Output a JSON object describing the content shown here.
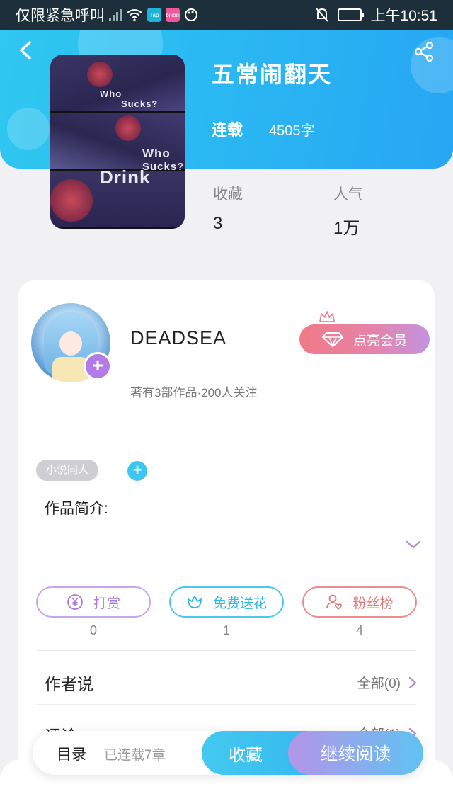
{
  "status_bar": {
    "carrier": "仅限紧急呼叫",
    "time": "上午10:51",
    "app_badges": [
      "Tap",
      "bilibili"
    ]
  },
  "book": {
    "title": "五常闹翻天",
    "serial_status": "连载",
    "word_count": "4505字",
    "favorites_label": "收藏",
    "favorites_value": "3",
    "popularity_label": "人气",
    "popularity_value": "1万",
    "cover_texts": [
      "Who",
      "Sucks?",
      "Who",
      "Sucks?",
      "Drink"
    ]
  },
  "author": {
    "name": "DEADSEA",
    "meta": "著有3部作品·200人关注",
    "vip_button": "点亮会员",
    "follow_icon": "plus-icon"
  },
  "tags": {
    "items": [
      "小说同人"
    ],
    "intro_label": "作品简介:"
  },
  "actions": [
    {
      "label": "打赏",
      "count": "0",
      "icon": "yen-coin-icon"
    },
    {
      "label": "免费送花",
      "count": "1",
      "icon": "flower-icon"
    },
    {
      "label": "粉丝榜",
      "count": "4",
      "icon": "fan-heart-icon"
    }
  ],
  "sections": [
    {
      "label": "作者说",
      "right": "全部(0)"
    },
    {
      "label": "评论",
      "right": "全部(1)"
    }
  ],
  "bottom_bar": {
    "toc_label": "目录",
    "chapter_status": "已连载7章",
    "favorite_label": "收藏",
    "continue_label": "继续阅读"
  },
  "colors": {
    "header_gradient_start": "#2fc8f0",
    "header_gradient_end": "#27a6f3",
    "vip_pink": "#f07a86",
    "vip_purple": "#c393e0",
    "accent_blue": "#3fc6ee",
    "accent_purple": "#b37ae8"
  }
}
